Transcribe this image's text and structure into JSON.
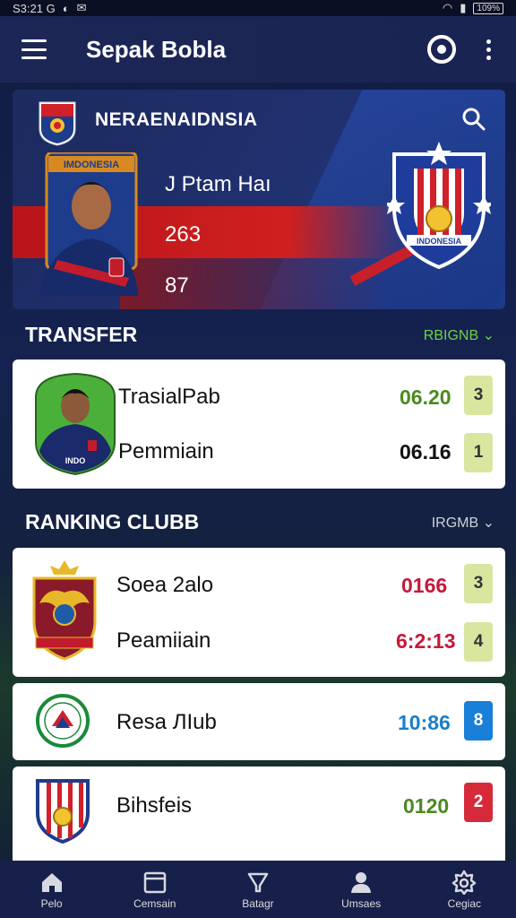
{
  "status_bar": {
    "time": "S3:21 G",
    "battery": "109%"
  },
  "app_bar": {
    "title": "Sepak Bobla"
  },
  "hero": {
    "country": "NERAENAIDNSIA",
    "player_name": "J Ptam Haı",
    "stat_1": "263",
    "stat_2": "87"
  },
  "transfer": {
    "title": "TRANSFER",
    "link": "RBIGNB ⌄",
    "rows": [
      {
        "label": "TrasialPab",
        "value": "06.20",
        "chip": "3"
      },
      {
        "label": "Pemmiain",
        "value": "06.16",
        "chip": "1"
      }
    ]
  },
  "ranking": {
    "title": "RANKING CLUBB",
    "link": "IRGMB ⌄",
    "card1": [
      {
        "label": "Soea 2alo",
        "value": "0166",
        "chip": "3"
      },
      {
        "label": "Peamiiain",
        "value": "6:2:13",
        "chip": "4"
      }
    ],
    "card2": {
      "label": "Resa ЛIub",
      "value": "10:86",
      "chip": "8"
    },
    "card3": {
      "label": "Bihsfeis",
      "value": "0120",
      "chip": "2"
    }
  },
  "colors": {
    "value_green": "#4a8a20",
    "value_red": "#c41a3a",
    "value_blue": "#1a7fc8",
    "link_green": "#6fd04a",
    "link_gray": "#d0d0d8"
  },
  "bottom_nav": [
    {
      "label": "Pelo",
      "icon": "home-icon"
    },
    {
      "label": "Cemsain",
      "icon": "calendar-icon"
    },
    {
      "label": "Batagr",
      "icon": "trophy-icon"
    },
    {
      "label": "Umsaes",
      "icon": "user-icon"
    },
    {
      "label": "Cegiac",
      "icon": "gear-icon"
    }
  ]
}
